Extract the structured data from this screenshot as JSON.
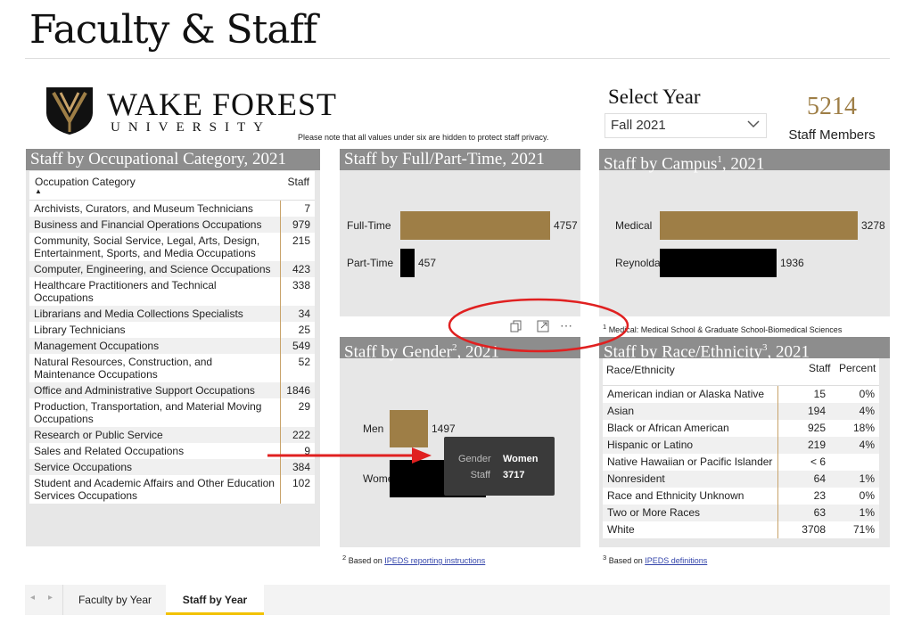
{
  "page": {
    "title": "Faculty & Staff"
  },
  "logo": {
    "line1": "WAKE FOREST",
    "line2": "UNIVERSITY"
  },
  "privacy_note": "Please note that all values under six are hidden to protect staff privacy.",
  "filter": {
    "label": "Select Year",
    "value": "Fall 2021"
  },
  "kpi": {
    "value": "5214",
    "label": "Staff Members"
  },
  "occupation": {
    "title": "Staff by Occupational Category, 2021",
    "col_category": "Occupation Category",
    "col_staff": "Staff",
    "rows": [
      {
        "name": "Archivists, Curators, and Museum Technicians",
        "staff": "7"
      },
      {
        "name": "Business and Financial Operations Occupations",
        "staff": "979"
      },
      {
        "name": "Community, Social Service, Legal, Arts, Design, Entertainment, Sports, and Media Occupations",
        "staff": "215"
      },
      {
        "name": "Computer, Engineering, and Science Occupations",
        "staff": "423"
      },
      {
        "name": "Healthcare Practitioners and Technical Occupations",
        "staff": "338"
      },
      {
        "name": "Librarians and Media Collections Specialists",
        "staff": "34"
      },
      {
        "name": "Library Technicians",
        "staff": "25"
      },
      {
        "name": "Management Occupations",
        "staff": "549"
      },
      {
        "name": "Natural Resources, Construction, and Maintenance Occupations",
        "staff": "52"
      },
      {
        "name": "Office and Administrative Support Occupations",
        "staff": "1846"
      },
      {
        "name": "Production, Transportation, and Material Moving Occupations",
        "staff": "29"
      },
      {
        "name": "Research or Public Service",
        "staff": "222"
      },
      {
        "name": "Sales and Related Occupations",
        "staff": "9"
      },
      {
        "name": "Service Occupations",
        "staff": "384"
      },
      {
        "name": "Student and Academic Affairs and Other Education Services Occupations",
        "staff": "102"
      }
    ]
  },
  "fulltime": {
    "title": "Staff by Full/Part-Time, 2021",
    "bars": [
      {
        "label": "Full-Time",
        "value": 4757,
        "text": "4757",
        "color": "#9e7e46"
      },
      {
        "label": "Part-Time",
        "value": 457,
        "text": "457",
        "color": "#000000"
      }
    ]
  },
  "campus": {
    "title_main": "Staff by Campus",
    "title_sup": "1",
    "title_year": ", 2021",
    "bars": [
      {
        "label": "Medical",
        "value": 3278,
        "text": "3278",
        "color": "#9e7e46"
      },
      {
        "label": "Reynolda",
        "value": 1936,
        "text": "1936",
        "color": "#000000"
      }
    ],
    "footnote_sup": "1",
    "footnote": "Medical: Medical School & Graduate School-Biomedical Sciences"
  },
  "gender": {
    "title_main": "Staff by Gender",
    "title_sup": "2",
    "title_year": ", 2021",
    "bars": [
      {
        "label": "Men",
        "value": 1497,
        "text": "1497",
        "color": "#9e7e46"
      },
      {
        "label": "Women",
        "value": 3717,
        "text": "3717",
        "color": "#000000"
      }
    ],
    "tooltip": {
      "k1": "Gender",
      "v1": "Women",
      "k2": "Staff",
      "v2": "3717"
    },
    "footnote_sup": "2",
    "footnote_pre": "Based on ",
    "footnote_link": "IPEDS reporting instructions"
  },
  "race": {
    "title_main": "Staff by Race/Ethnicity",
    "title_sup": "3",
    "title_year": ", 2021",
    "col_name": "Race/Ethnicity",
    "col_staff": "Staff",
    "col_pct": "Percent",
    "rows": [
      {
        "name": "American indian or Alaska Native",
        "staff": "15",
        "pct": "0%"
      },
      {
        "name": "Asian",
        "staff": "194",
        "pct": "4%"
      },
      {
        "name": "Black or African American",
        "staff": "925",
        "pct": "18%"
      },
      {
        "name": "Hispanic or Latino",
        "staff": "219",
        "pct": "4%"
      },
      {
        "name": "Native Hawaiian or Pacific Islander",
        "staff": "< 6",
        "pct": ""
      },
      {
        "name": "Nonresident",
        "staff": "64",
        "pct": "1%"
      },
      {
        "name": "Race and Ethnicity Unknown",
        "staff": "23",
        "pct": "0%"
      },
      {
        "name": "Two or More Races",
        "staff": "63",
        "pct": "1%"
      },
      {
        "name": "White",
        "staff": "3708",
        "pct": "71%"
      }
    ],
    "footnote_sup": "3",
    "footnote_pre": "Based on ",
    "footnote_link": "IPEDS definitions"
  },
  "tabs": [
    {
      "label": "Faculty by Year",
      "active": false
    },
    {
      "label": "Staff by Year",
      "active": true
    }
  ],
  "colors": {
    "gold": "#9e7e46",
    "header_gray": "#8d8d8d",
    "panel_gray": "#e7e7e7",
    "annotation_red": "#e02020",
    "tab_active": "#f2c200"
  }
}
